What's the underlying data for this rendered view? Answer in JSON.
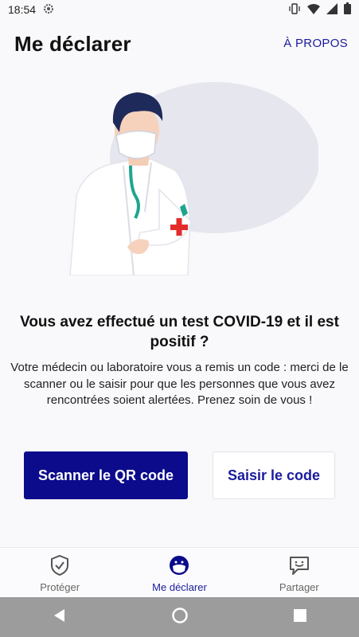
{
  "status_bar": {
    "time": "18:54"
  },
  "header": {
    "title": "Me déclarer",
    "about": "À PROPOS"
  },
  "main": {
    "question": "Vous avez effectué un test COVID-19 et il est positif ?",
    "description": "Votre médecin ou laboratoire vous a remis un code : merci de le scanner ou le saisir pour que les personnes que vous avez rencontrées soient alertées. Prenez soin de vous !",
    "scan_button": "Scanner le QR code",
    "enter_code_button": "Saisir le code"
  },
  "bottom_nav": {
    "items": [
      {
        "label": "Protéger",
        "icon": "shield-check-icon",
        "active": false
      },
      {
        "label": "Me déclarer",
        "icon": "masked-face-icon",
        "active": true
      },
      {
        "label": "Partager",
        "icon": "chat-smile-icon",
        "active": false
      }
    ]
  },
  "colors": {
    "accent": "#0b0b8c",
    "link": "#1b1b9c",
    "background": "#f9f9fb"
  }
}
